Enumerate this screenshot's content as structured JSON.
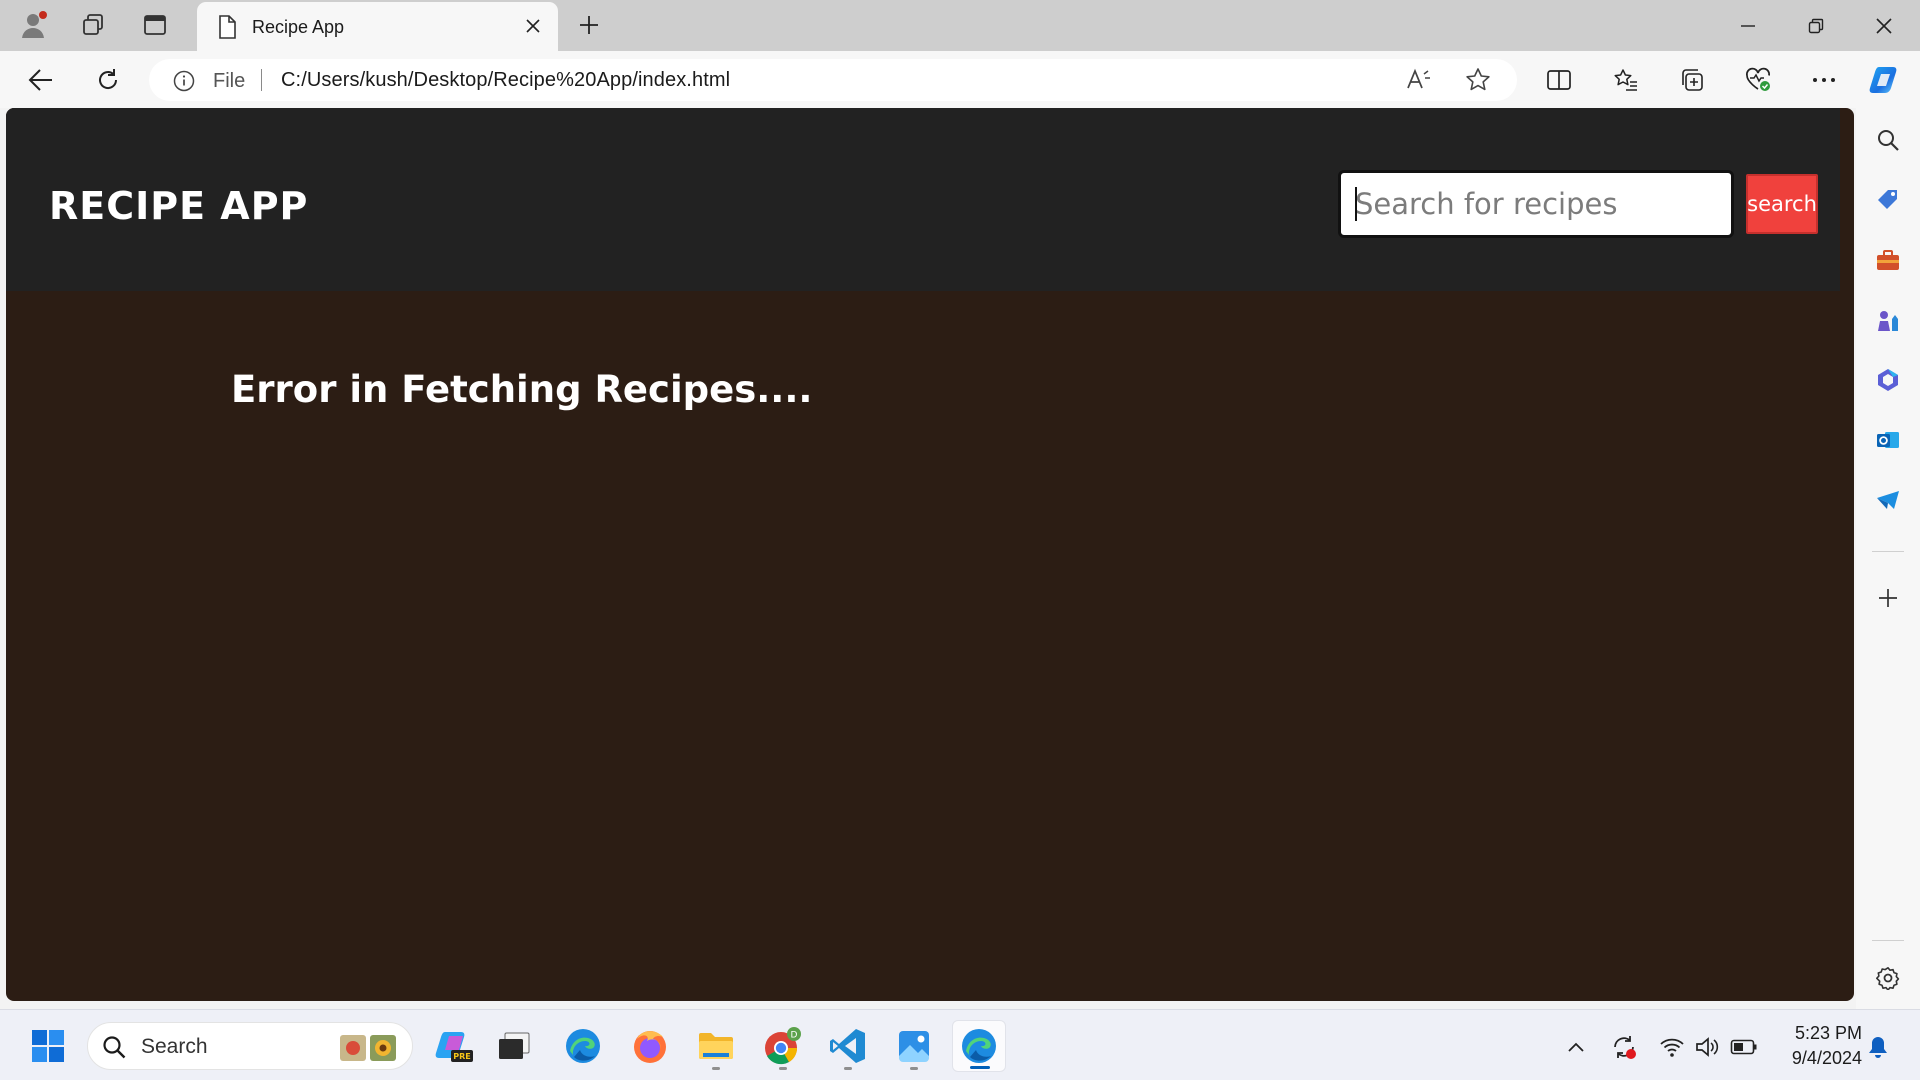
{
  "browser": {
    "tab": {
      "title": "Recipe App"
    },
    "address": {
      "scheme_label": "File",
      "url": "C:/Users/kush/Desktop/Recipe%20App/index.html"
    },
    "toolbar_icons": [
      "back-icon",
      "refresh-icon",
      "read-aloud-icon",
      "favorite-star-icon",
      "split-screen-icon",
      "favorites-icon",
      "collections-icon",
      "browser-essentials-icon",
      "more-icon",
      "copilot-icon"
    ],
    "sidebar_icons": [
      "search-icon",
      "shopping-icon",
      "tools-icon",
      "games-icon",
      "microsoft-365-icon",
      "outlook-icon",
      "telegram-icon",
      "add-icon",
      "settings-icon"
    ]
  },
  "app": {
    "logo": "RECIPE APP",
    "search": {
      "placeholder": "Search for recipes",
      "value": "",
      "button_label": "search"
    },
    "message": "Error in Fetching Recipes...."
  },
  "taskbar": {
    "search_label": "Search",
    "apps": [
      "start-icon",
      "copilot-pre-icon",
      "terminal-icon",
      "edge-icon",
      "firefox-icon",
      "file-explorer-icon",
      "chrome-icon",
      "vscode-icon",
      "photos-icon",
      "edge-active-icon"
    ],
    "clock": {
      "time": "5:23 PM",
      "date": "9/4/2024"
    }
  },
  "colors": {
    "accent_button": "#f0413d",
    "app_header": "#222222",
    "app_background": "#2c1d14"
  }
}
